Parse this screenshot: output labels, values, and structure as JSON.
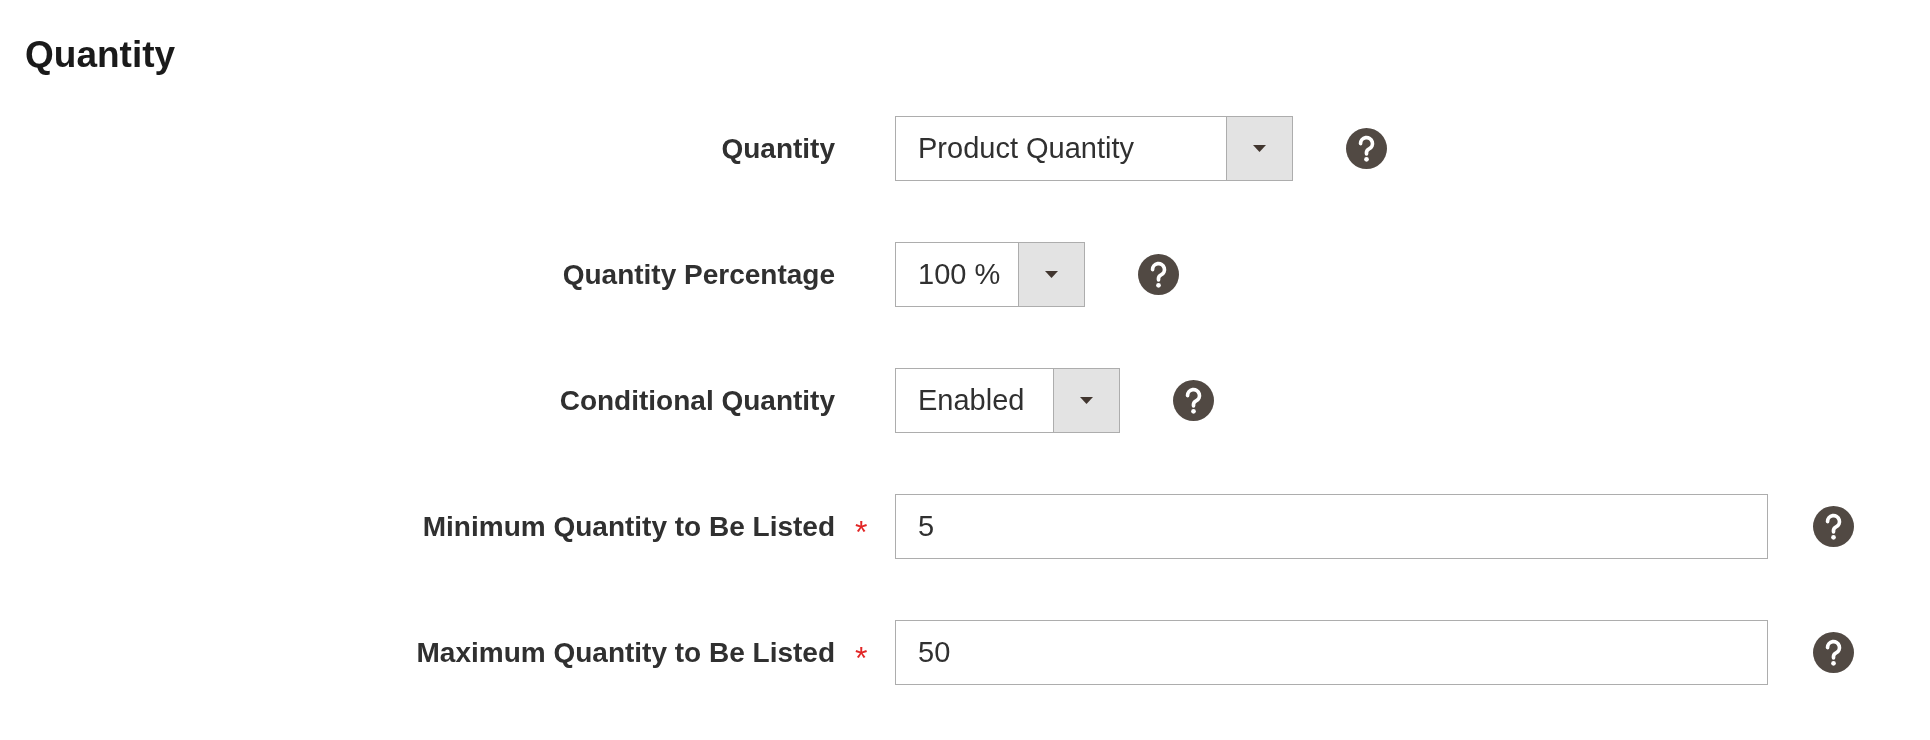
{
  "section": {
    "title": "Quantity"
  },
  "fields": [
    {
      "kind": "select",
      "label": "Quantity",
      "value": "Product Quantity"
    },
    {
      "kind": "select",
      "label": "Quantity Percentage",
      "value": "100 %"
    },
    {
      "kind": "select",
      "label": "Conditional Quantity",
      "value": "Enabled"
    },
    {
      "kind": "text",
      "label": "Minimum Quantity to Be Listed",
      "required_mark": "*",
      "value": "5"
    },
    {
      "kind": "text",
      "label": "Maximum Quantity to Be Listed",
      "required_mark": "*",
      "value": "50"
    }
  ]
}
